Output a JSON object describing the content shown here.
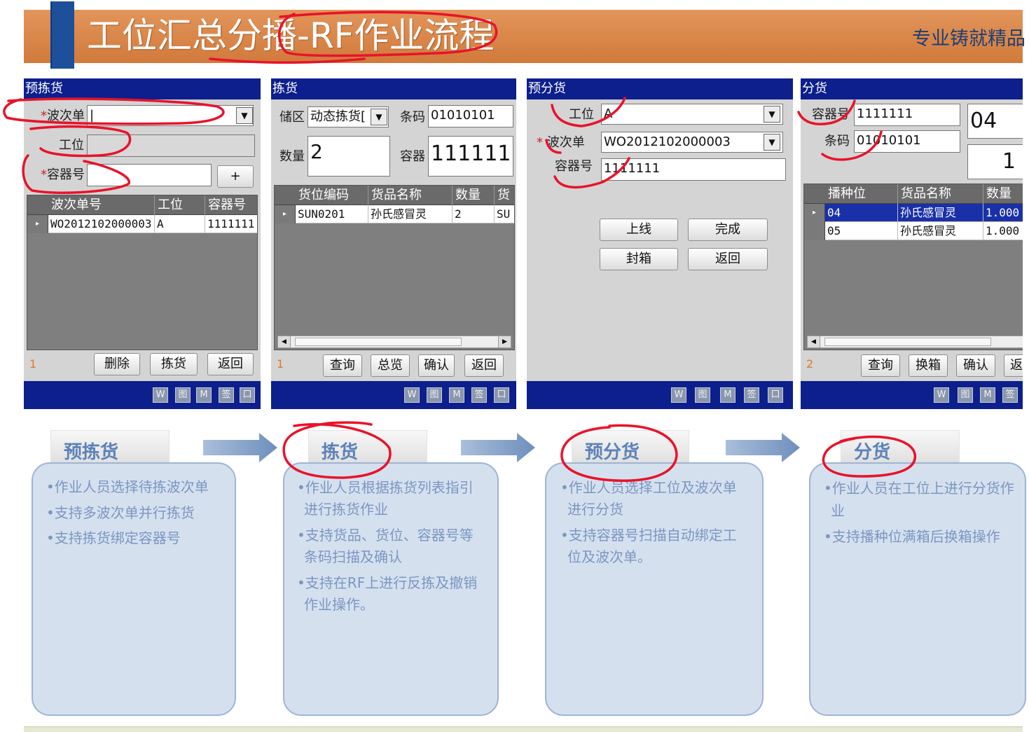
{
  "header": {
    "title": "工位汇总分播-RF作业流程",
    "right_text": "专业铸就精品"
  },
  "footer_icons": [
    "W",
    "图",
    "M",
    "签",
    "口"
  ],
  "screens": {
    "prepick": {
      "bar_title": "预拣货",
      "wave_label": "波次单",
      "station_label": "工位",
      "container_label": "容器号",
      "plus_label": "+",
      "columns": [
        "波次单号",
        "工位",
        "容器号"
      ],
      "row": [
        "WO2012102000003",
        "A",
        "1111111"
      ],
      "count": "1",
      "buttons": [
        "删除",
        "拣货",
        "返回"
      ]
    },
    "pick": {
      "bar_title": "拣货",
      "zone_label": "储区",
      "zone_value": "动态拣货[",
      "barcode_label": "条码",
      "barcode_value": "01010101",
      "qty_label": "数量",
      "qty_value": "2",
      "container_label": "容器",
      "container_value": "1111111",
      "columns": [
        "货位编码",
        "货品名称",
        "数量",
        "货"
      ],
      "row": [
        "SUN0201",
        "孙氏感冒灵",
        "2",
        "SU"
      ],
      "count": "1",
      "buttons": [
        "查询",
        "总览",
        "确认",
        "返回"
      ]
    },
    "predist": {
      "bar_title": "预分货",
      "station_label": "工位",
      "station_value": "A",
      "wave_label": "波次单",
      "wave_value": "WO2012102000003",
      "container_label": "容器号",
      "container_value": "1111111",
      "buttons": [
        "上线",
        "完成",
        "封箱",
        "返回"
      ]
    },
    "dist": {
      "bar_title": "分货",
      "container_label": "容器号",
      "container_value": "1111111",
      "barcode_label": "条码",
      "barcode_value": "01010101",
      "big_value_1": "04",
      "big_value_2": "1",
      "columns": [
        "播种位",
        "货品名称",
        "数量"
      ],
      "rows": [
        [
          "04",
          "孙氏感冒灵",
          "1.000"
        ],
        [
          "05",
          "孙氏感冒灵",
          "1.000"
        ]
      ],
      "count": "2",
      "buttons": [
        "查询",
        "换箱",
        "确认",
        "返"
      ]
    }
  },
  "steps": [
    {
      "title": "预拣货",
      "lines": [
        "•作业人员选择待拣波次单",
        "•支持多波次单并行拣货",
        "•支持拣货绑定容器号"
      ]
    },
    {
      "title": "拣货",
      "lines": [
        "•作业人员根据拣货列表指引",
        "进行拣货作业",
        "•支持货品、货位、容器号等",
        "条码扫描及确认",
        "•支持在RF上进行反拣及撤销",
        "作业操作。"
      ]
    },
    {
      "title": "预分货",
      "lines": [
        "•作业人员选择工位及波次单",
        "进行分货",
        "•支持容器号扫描自动绑定工",
        "位及波次单。"
      ]
    },
    {
      "title": "分货",
      "lines": [
        "•作业人员在工位上进行分货作",
        "业",
        "•支持播种位满箱后换箱操作"
      ]
    }
  ],
  "colors": {
    "header_orange": "#d9854a",
    "rf_blue": "#0d1f8c",
    "selected_row": "#1a30a8",
    "card_fill": "#d5e0ef",
    "annotation_red": "#e8132a"
  }
}
